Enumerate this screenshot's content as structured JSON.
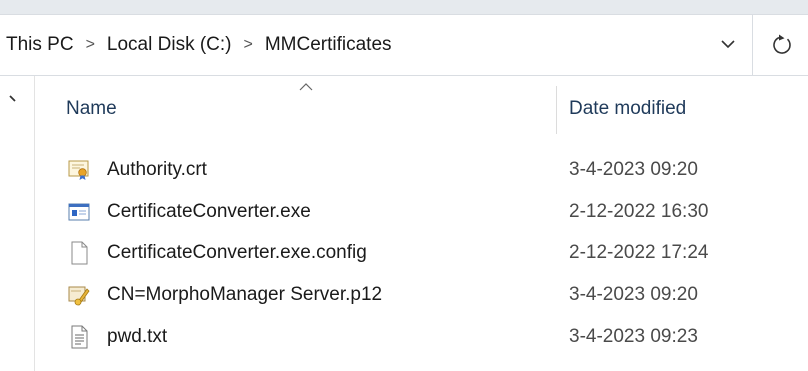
{
  "breadcrumb": {
    "items": [
      "This PC",
      "Local Disk (C:)",
      "MMCertificates"
    ],
    "separator": ">"
  },
  "columns": {
    "name": "Name",
    "date_modified": "Date modified"
  },
  "files": [
    {
      "name": "Authority.crt",
      "date": "3-4-2023 09:20",
      "icon": "certificate-icon"
    },
    {
      "name": "CertificateConverter.exe",
      "date": "2-12-2022 16:30",
      "icon": "application-icon"
    },
    {
      "name": "CertificateConverter.exe.config",
      "date": "2-12-2022 17:24",
      "icon": "blank-file-icon"
    },
    {
      "name": "CN=MorphoManager Server.p12",
      "date": "3-4-2023 09:20",
      "icon": "personal-certificate-icon"
    },
    {
      "name": "pwd.txt",
      "date": "3-4-2023 09:23",
      "icon": "text-file-icon"
    }
  ]
}
